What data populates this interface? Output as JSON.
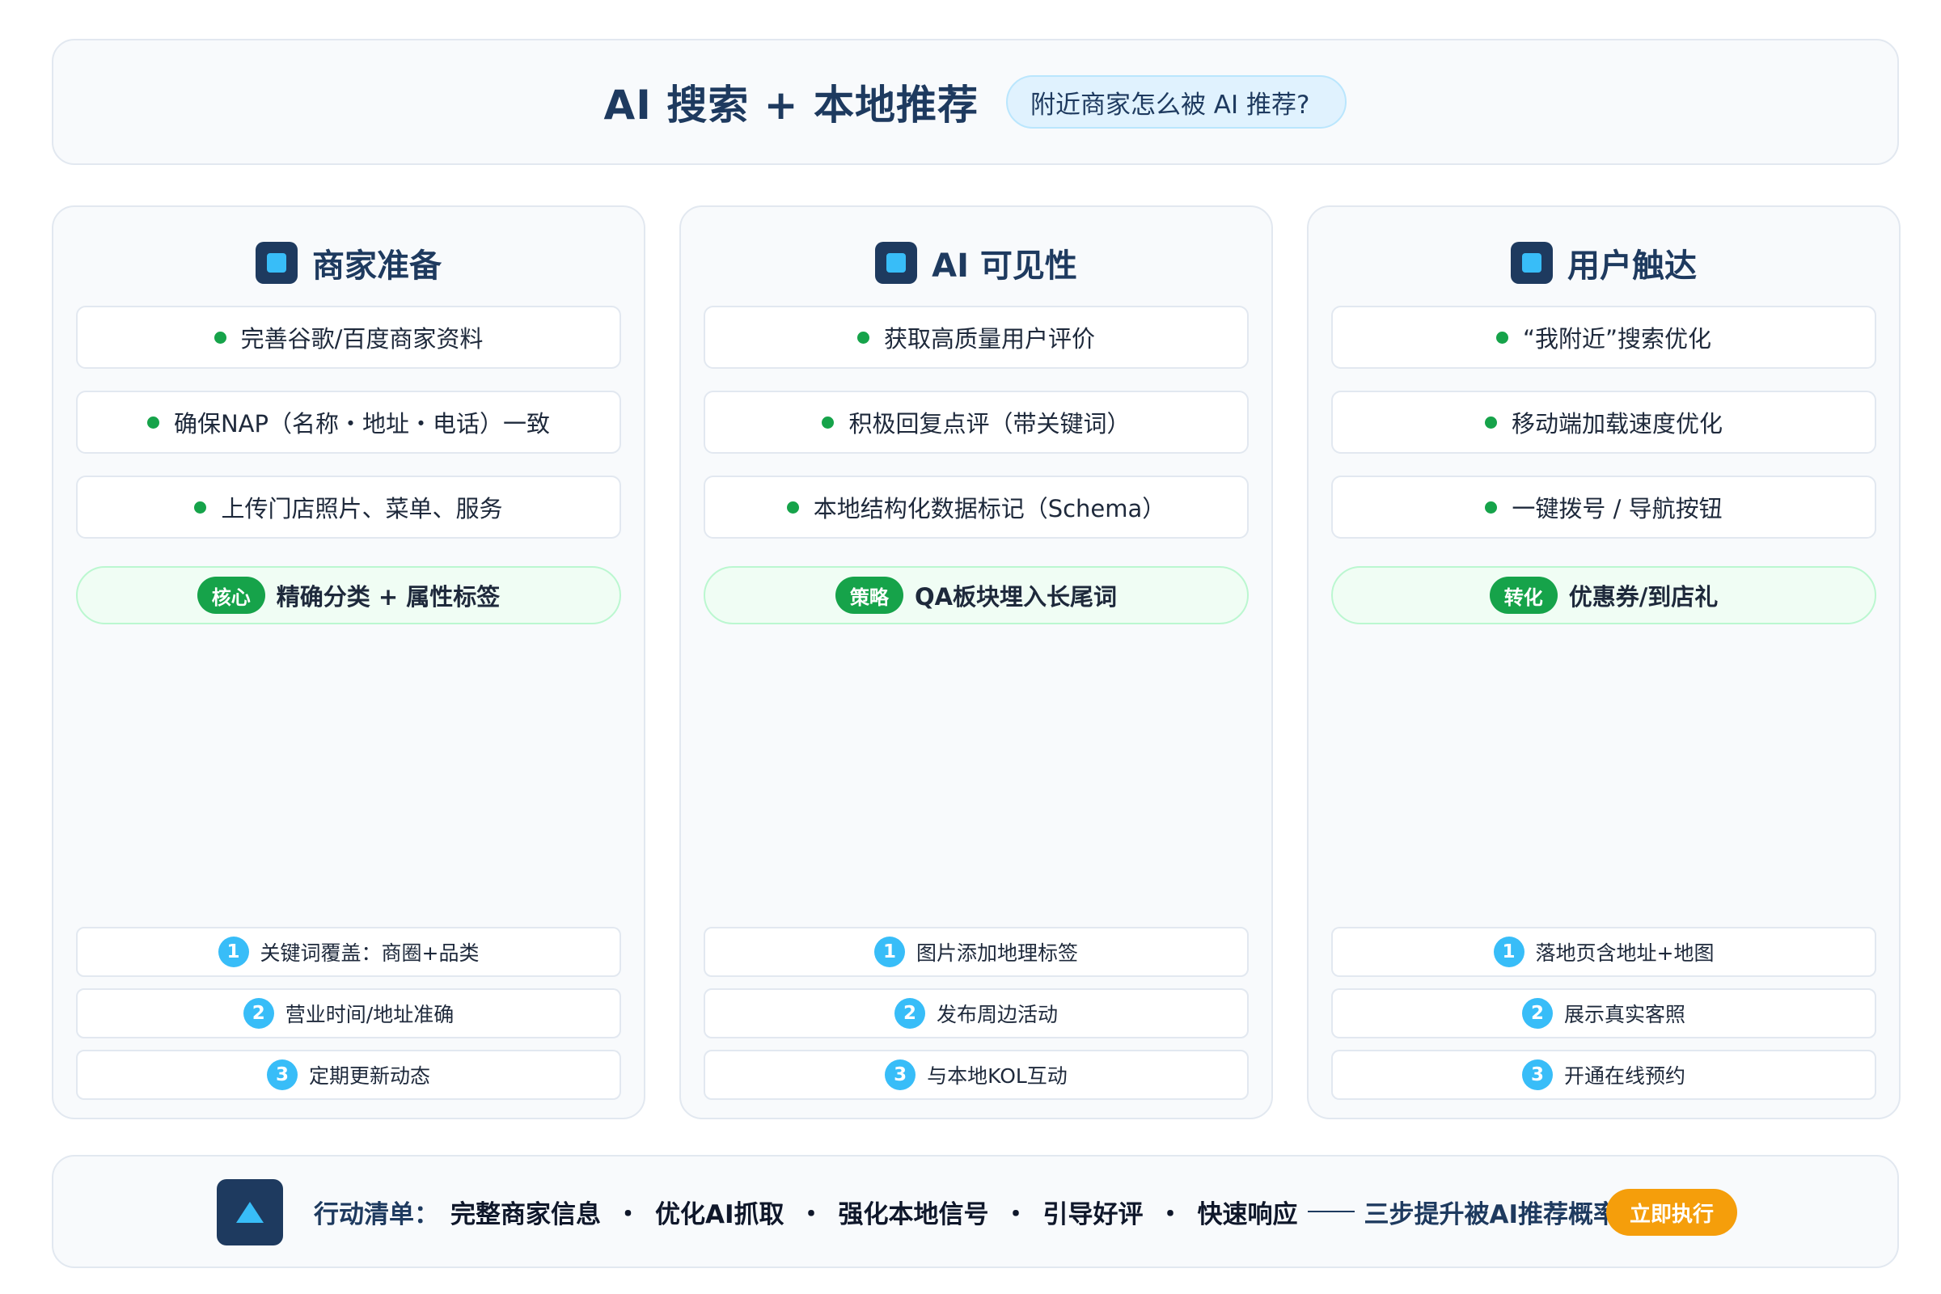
{
  "header": {
    "title": "AI 搜索 + 本地推荐",
    "subtitle": "附近商家怎么被 AI 推荐?"
  },
  "columns": [
    {
      "title": "商家准备",
      "items": [
        "完善谷歌/百度商家资料",
        "确保NAP（名称・地址・电话）一致",
        "上传门店照片、菜单、服务"
      ],
      "badge": "核心",
      "highlight": "精确分类 + 属性标签",
      "steps": [
        "关键词覆盖：商圈+品类",
        "营业时间/地址准确",
        "定期更新动态"
      ]
    },
    {
      "title": "AI 可见性",
      "items": [
        "获取高质量用户评价",
        "积极回复点评（带关键词）",
        "本地结构化数据标记（Schema）"
      ],
      "badge": "策略",
      "highlight": "QA板块埋入长尾词",
      "steps": [
        "图片添加地理标签",
        "发布周边活动",
        "与本地KOL互动"
      ]
    },
    {
      "title": "用户触达",
      "items": [
        "“我附近”搜索优化",
        "移动端加载速度优化",
        "一键拨号 / 导航按钮"
      ],
      "badge": "转化",
      "highlight": "优惠券/到店礼",
      "steps": [
        "落地页含地址+地图",
        "展示真实客照",
        "开通在线预约"
      ]
    }
  ],
  "step_numbers": [
    "1",
    "2",
    "3"
  ],
  "footer": {
    "label": "行动清单：",
    "items": [
      "完整商家信息",
      "优化AI抓取",
      "强化本地信号",
      "引导好评",
      "快速响应"
    ],
    "separator": "・",
    "tail": "三步提升被AI推荐概率",
    "button": "立即执行"
  },
  "colors": {
    "navy": "#1e3a5f",
    "sky": "#38bdf8",
    "green": "#16a34a",
    "amber": "#f59e0b"
  },
  "icons": {
    "column_head": "square-icon",
    "footer": "triangle-up-icon"
  }
}
